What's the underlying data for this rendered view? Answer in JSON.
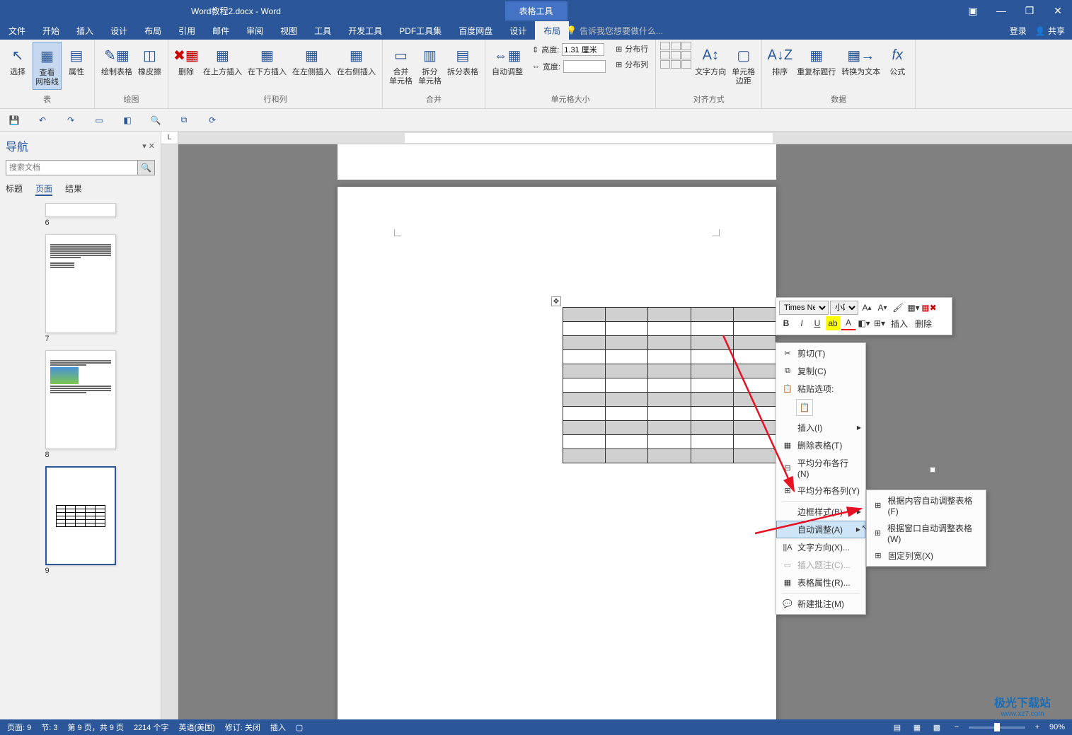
{
  "title": "Word教程2.docx - Word",
  "table_tools": "表格工具",
  "win": {
    "help": "?",
    "min": "—",
    "max": "❐",
    "close": "✕",
    "boxed": "▣"
  },
  "tabs": [
    "文件",
    "开始",
    "插入",
    "设计",
    "布局",
    "引用",
    "邮件",
    "审阅",
    "视图",
    "工具",
    "开发工具",
    "PDF工具集",
    "百度网盘",
    "设计",
    "布局"
  ],
  "tell_me": "告诉我您想要做什么...",
  "login": "登录",
  "share": "共享",
  "ribbon": {
    "g1": {
      "select": "选择",
      "view_grid": "查看\n网格线",
      "props": "属性",
      "label": "表"
    },
    "g2": {
      "draw": "绘制表格",
      "eraser": "橡皮擦",
      "label": "绘图"
    },
    "g3": {
      "delete": "删除",
      "above": "在上方插入",
      "below": "在下方插入",
      "left": "在左侧插入",
      "right": "在右侧插入",
      "label": "行和列"
    },
    "g4": {
      "merge": "合并\n单元格",
      "split": "拆分\n单元格",
      "split_tbl": "拆分表格",
      "label": "合并"
    },
    "g5": {
      "autofit": "自动调整",
      "height": "高度:",
      "height_val": "1.31 厘米",
      "width": "宽度:",
      "width_val": "",
      "dist_row": "分布行",
      "dist_col": "分布列",
      "label": "单元格大小"
    },
    "g6": {
      "text_dir": "文字方向",
      "margins": "单元格\n边距",
      "label": "对齐方式"
    },
    "g7": {
      "sort": "排序",
      "repeat": "重复标题行",
      "convert": "转换为文本",
      "formula": "公式",
      "label": "数据"
    }
  },
  "nav": {
    "title": "导航",
    "search_ph": "搜索文档",
    "tabs": [
      "标题",
      "页面",
      "结果"
    ],
    "pages": [
      "6",
      "7",
      "8",
      "9"
    ]
  },
  "ruler_corner": "L",
  "mini": {
    "font": "Times New",
    "size": "小四",
    "insert": "插入",
    "delete": "删除"
  },
  "ctx": {
    "cut": "剪切(T)",
    "copy": "复制(C)",
    "paste_opt": "粘贴选项:",
    "insert": "插入(I)",
    "del_tbl": "删除表格(T)",
    "dist_row": "平均分布各行(N)",
    "dist_col": "平均分布各列(Y)",
    "border": "边框样式(B)",
    "autofit": "自动调整(A)",
    "text_dir": "文字方向(X)...",
    "ins_cap": "插入题注(C)...",
    "tbl_prop": "表格属性(R)...",
    "new_comment": "新建批注(M)"
  },
  "submenu": {
    "by_content": "根据内容自动调整表格(F)",
    "by_window": "根据窗口自动调整表格(W)",
    "fixed": "固定列宽(X)"
  },
  "status": {
    "page": "页面: 9",
    "section": "节: 3",
    "page_of": "第 9 页，共 9 页",
    "words": "2214 个字",
    "lang": "英语(美国)",
    "track": "修订: 关闭",
    "insert_mode": "插入",
    "zoom": "90%"
  },
  "watermark": {
    "name": "极光下载站",
    "url": "www.xz7.com"
  }
}
